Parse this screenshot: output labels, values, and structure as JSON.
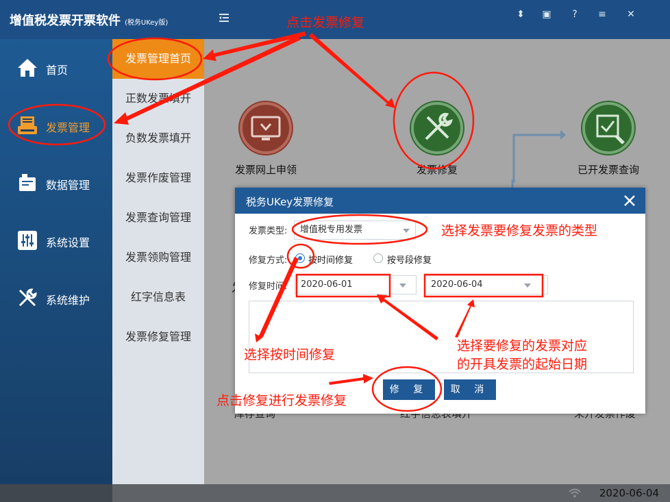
{
  "header": {
    "app_title": "增值税发票开票软件",
    "app_subtitle": "(税务UKey版)",
    "icons": [
      "collapse-icon",
      "user-icon",
      "window-icon",
      "help-icon",
      "menu-icon",
      "close-icon"
    ],
    "icon_glyphs": {
      "user": "⬍",
      "window": "▣",
      "help": "?",
      "menu": "≡",
      "close": "✕"
    },
    "color": "#1d4f86"
  },
  "sidebar": {
    "items": [
      {
        "label": "首页",
        "icon": "home-icon"
      },
      {
        "label": "发票管理",
        "icon": "invoice-icon",
        "active": true
      },
      {
        "label": "数据管理",
        "icon": "data-icon"
      },
      {
        "label": "系统设置",
        "icon": "settings-sliders-icon"
      },
      {
        "label": "系统维护",
        "icon": "wrench-icon"
      }
    ],
    "active_color": "#f39c2b"
  },
  "submenu": {
    "items": [
      {
        "label": "发票管理首页",
        "active": true
      },
      {
        "label": "正数发票填开"
      },
      {
        "label": "负数发票填开"
      },
      {
        "label": "发票作废管理"
      },
      {
        "label": "发票查询管理"
      },
      {
        "label": "发票领购管理"
      },
      {
        "label": "红字信息表"
      },
      {
        "label": "发票修复管理"
      }
    ],
    "active_color": "#ee8b16"
  },
  "main": {
    "functions": [
      {
        "label": "发票网上申领",
        "icon": "monitor-download-icon",
        "color": "#8a3b2e"
      },
      {
        "label": "发票修复",
        "icon": "tools-icon",
        "color": "#2f6b2f"
      },
      {
        "label": "已开发票查询",
        "icon": "search-doc-icon",
        "color": "#2f6b2f"
      }
    ],
    "bottom_labels": [
      "库存查询",
      "红字信息表填开",
      "未开发票作废"
    ],
    "hidden_partial": "发"
  },
  "dialog": {
    "title": "税务UKey发票修复",
    "invoice_type_label": "发票类型:",
    "invoice_type_value": "增值税专用发票",
    "repair_mode_label": "修复方式:",
    "mode_options": [
      {
        "label": "按时间修复",
        "checked": true
      },
      {
        "label": "按号段修复",
        "checked": false
      }
    ],
    "repair_time_label": "修复时间:",
    "start_date": "2020-06-01",
    "end_date": "2020-06-04",
    "repair_button": "修 复",
    "cancel_button": "取 消",
    "title_color": "#1f5a96"
  },
  "status": {
    "date": "2020-06-04"
  },
  "annotations": {
    "click_repair": "点击发票修复",
    "select_type": "选择发票要修复发票的类型",
    "select_by_time": "选择按时间修复",
    "select_dates_1": "选择要修复的发票对应",
    "select_dates_2": "的开具发票的起始日期",
    "click_repair_go": "点击修复进行发票修复",
    "color": "#ff1a0a"
  }
}
